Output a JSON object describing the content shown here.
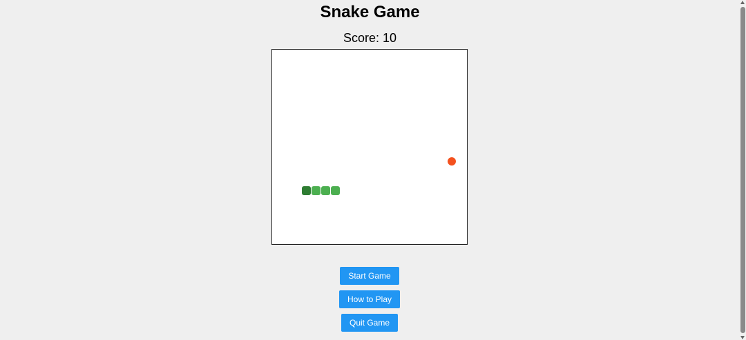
{
  "title": "Snake Game",
  "score_text": "Score: 10",
  "game": {
    "snake_segments": 4,
    "colors": {
      "snake_head": "#2e7d32",
      "snake_body": "#4caf50",
      "food": "#f4511e",
      "board_background": "#ffffff"
    }
  },
  "buttons": {
    "start": "Start Game",
    "how_to_play": "How to Play",
    "quit": "Quit Game",
    "color": "#2196f3"
  }
}
